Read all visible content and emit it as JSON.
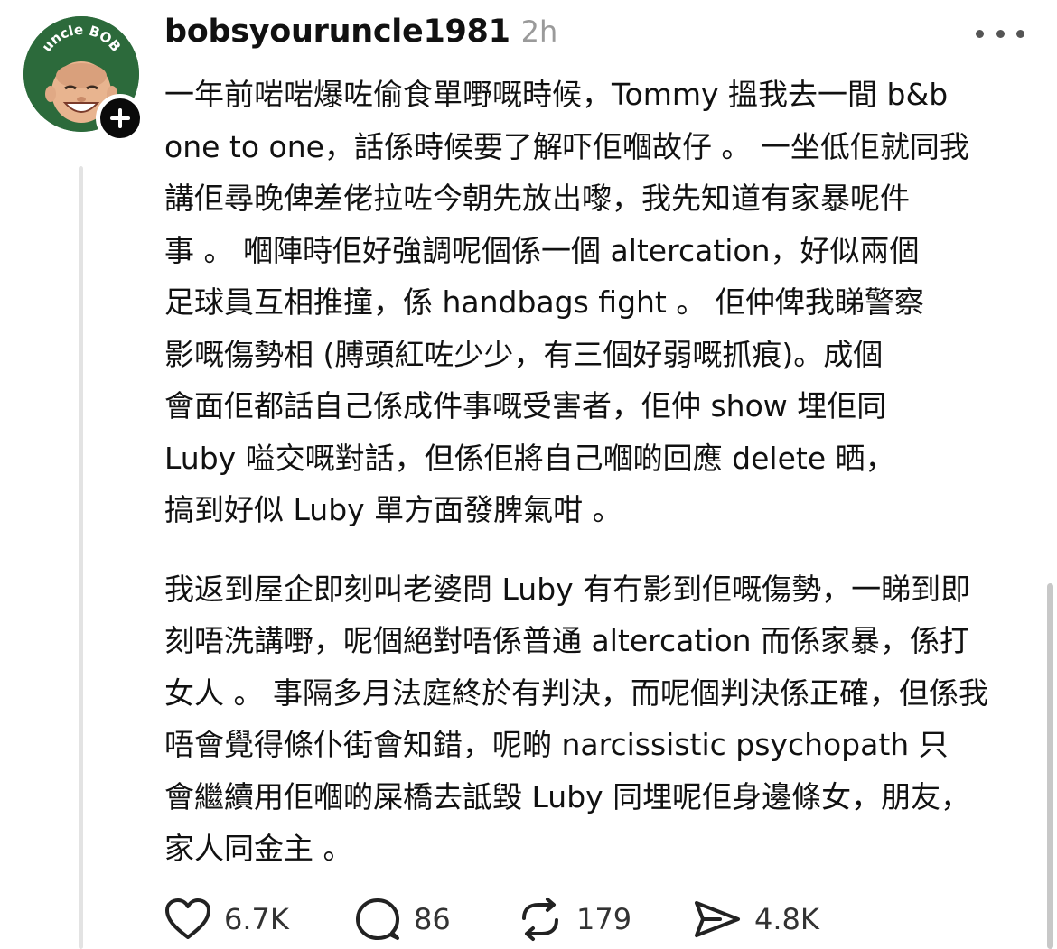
{
  "post": {
    "username": "bobsyouruncle1981",
    "time": "2h",
    "avatar_text": "uncle BOB",
    "paragraphs": [
      "一年前啱啱爆咗偷食單嘢嘅時候，Tommy 搵我去一間 b&b\none to one，話係時候要了解吓佢嗰故仔 。 一坐低佢就同我\n講佢尋晚俾差佬拉咗今朝先放出嚟，我先知道有家暴呢件\n事 。  嗰陣時佢好強調呢個係一個 altercation，好似兩個\n足球員互相推撞，係 handbags fight 。  佢仲俾我睇警察\n影嘅傷勢相 (膊頭紅咗少少，有三個好弱嘅抓痕)。成個\n會面佢都話自己係成件事嘅受害者，佢仲 show 埋佢同\nLuby 嗌交嘅對話，但係佢將自己嗰啲回應 delete 晒，\n搞到好似 Luby 單方面發脾氣咁 。",
      "我返到屋企即刻叫老婆問 Luby 有冇影到佢嘅傷勢，一睇到即\n刻唔洗講嘢，呢個絕對唔係普通 altercation 而係家暴，係打\n女人 。 事隔多月法庭終於有判決，而呢個判決係正確，但係我\n唔會覺得條仆街會知錯，呢啲 narcissistic psychopath 只\n會繼續用佢嗰啲屎橋去詆毀 Luby 同埋呢佢身邊條女，朋友，\n家人同金主 。"
    ]
  },
  "actions": {
    "likes": "6.7K",
    "replies": "86",
    "reposts": "179",
    "shares": "4.8K"
  },
  "icons": {
    "like": "heart-icon",
    "reply": "speech-bubble-icon",
    "repost": "repost-icon",
    "share": "send-icon",
    "follow": "plus-icon",
    "more": "more-dots-icon"
  },
  "colors": {
    "avatar_bg": "#2c6a3b",
    "text": "#111111",
    "muted": "#9a9a9a"
  }
}
